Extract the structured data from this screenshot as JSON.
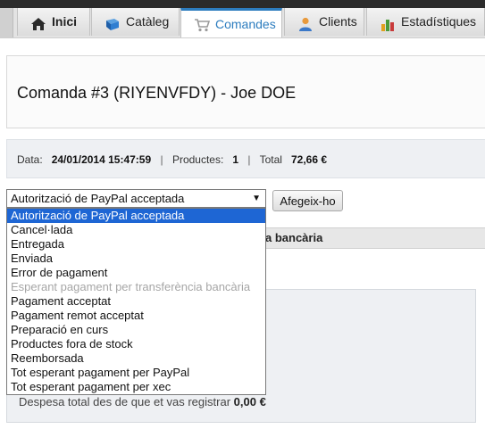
{
  "tabs": [
    {
      "label": "Inici",
      "icon": "home-icon"
    },
    {
      "label": "Catàleg",
      "icon": "book-icon"
    },
    {
      "label": "Comandes",
      "icon": "cart-icon"
    },
    {
      "label": "Clients",
      "icon": "user-icon"
    },
    {
      "label": "Estadístiques",
      "icon": "bar-chart-icon"
    }
  ],
  "order": {
    "title": "Comanda #3 (RIYENVFDY) - Joe DOE"
  },
  "info": {
    "date_label": "Data:",
    "date_value": "24/01/2014 15:47:59",
    "sep": "|",
    "products_label": "Productes:",
    "products_value": "1",
    "total_label": "Total",
    "total_value": "72,66 €"
  },
  "status_select": {
    "value": "Autorització de PayPal acceptada",
    "arrow": "▼",
    "options": [
      {
        "label": "Autorització de PayPal acceptada",
        "state": "selected"
      },
      {
        "label": "Cancel·lada",
        "state": "normal"
      },
      {
        "label": "Entregada",
        "state": "normal"
      },
      {
        "label": "Enviada",
        "state": "normal"
      },
      {
        "label": "Error de pagament",
        "state": "normal"
      },
      {
        "label": "Esperant pagament per transferència bancària",
        "state": "disabled"
      },
      {
        "label": "Pagament acceptat",
        "state": "normal"
      },
      {
        "label": "Pagament remot acceptat",
        "state": "normal"
      },
      {
        "label": "Preparació en curs",
        "state": "normal"
      },
      {
        "label": "Productes fora de stock",
        "state": "normal"
      },
      {
        "label": "Reemborsada",
        "state": "normal"
      },
      {
        "label": "Tot esperant pagament per PayPal",
        "state": "normal"
      },
      {
        "label": "Tot esperant pagament per xec",
        "state": "normal"
      }
    ]
  },
  "add_button": {
    "label": "Afegeix-ho"
  },
  "table_header": {
    "partial_label": "a bancària"
  },
  "summary": {
    "label": "Despesa total des de que et vas registrar",
    "value": "0,00 €"
  },
  "colors": {
    "accent": "#2d7dbf",
    "selection": "#1e66d4"
  }
}
